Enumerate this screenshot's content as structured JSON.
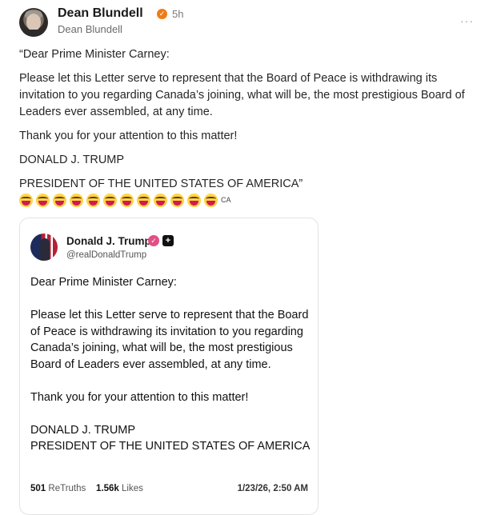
{
  "post": {
    "author_name": "Dean Blundell",
    "verified_icon": "checkmark-badge",
    "verified_color": "#f07c16",
    "timestamp": "5h",
    "author_handle": "Dean Blundell",
    "more_icon": "···",
    "paragraphs": [
      "“Dear Prime Minister Carney:",
      "Please let this Letter serve to represent that the Board of Peace is withdrawing its invitation to you regarding Canada’s joining, what will be, the most prestigious Board of Leaders ever assembled, at any time.",
      "Thank you for your attention to this matter!",
      "DONALD J. TRUMP",
      "PRESIDENT OF THE UNITED STATES OF AMERICA”"
    ],
    "emoji_name": "laughing-face-emoji",
    "emoji_count": 12,
    "emoji_suffix": "CA"
  },
  "quote": {
    "author_name": "Donald J. Trump",
    "verified_color": "#e04f86",
    "plus_icon": "+",
    "author_handle": "@realDonaldTrump",
    "greeting": "Dear Prime Minister Carney:",
    "body": "Please let this Letter serve to represent that the Board of Peace is withdrawing its invitation to you regarding Canada’s joining, what will be, the most prestigious Board of Leaders ever assembled, at any time.",
    "thanks": "Thank you for your attention to this matter!",
    "signature_name": "DONALD J. TRUMP",
    "signature_title": "PRESIDENT OF THE UNITED STATES OF AMERICA",
    "retruths_count": "501",
    "retruths_label": "ReTruths",
    "likes_count": "1.56k",
    "likes_label": "Likes",
    "date": "1/23/26, 2:50 AM"
  }
}
